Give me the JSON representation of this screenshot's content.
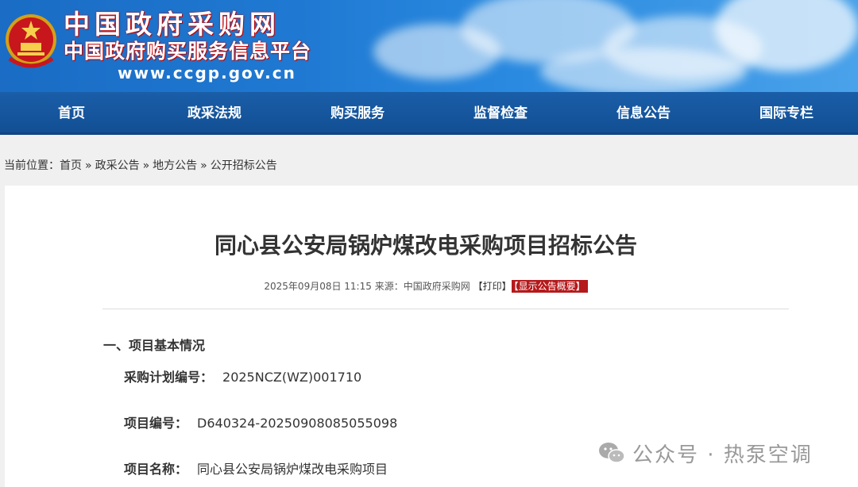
{
  "header": {
    "site_name": "中国政府采购网",
    "site_subtitle": "中国政府购买服务信息平台",
    "site_url": "www.ccgp.gov.cn"
  },
  "nav": {
    "items": [
      {
        "label": "首页"
      },
      {
        "label": "政采法规"
      },
      {
        "label": "购买服务"
      },
      {
        "label": "监督检查"
      },
      {
        "label": "信息公告"
      },
      {
        "label": "国际专栏"
      }
    ]
  },
  "breadcrumb": {
    "prefix": "当前位置：",
    "items": [
      "首页",
      "政采公告",
      "地方公告",
      "公开招标公告"
    ],
    "separator": "»"
  },
  "article": {
    "title": "同心县公安局锅炉煤改电采购项目招标公告",
    "datetime": "2025年09月08日 11:15",
    "source_label": "来源：",
    "source": "中国政府采购网",
    "print_label": "【打印】",
    "summary_label": "【显示公告概要】",
    "section_title": "一、项目基本情况",
    "fields": [
      {
        "key": "采购计划编号：",
        "value": "2025NCZ(WZ)001710"
      },
      {
        "key": "项目编号：",
        "value": "D640324-20250908085055098"
      },
      {
        "key": "项目名称：",
        "value": "同心县公安局锅炉煤改电采购项目"
      }
    ]
  },
  "watermark": {
    "text": "公众号 · 热泵空调",
    "icon": "wechat-icon"
  },
  "colors": {
    "nav_bg": "#1a5ea8",
    "summary_button": "#b5191b",
    "header_blue": "#1f79d2"
  }
}
